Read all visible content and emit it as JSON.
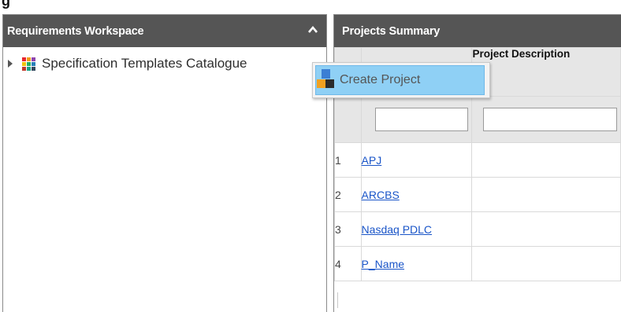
{
  "left_panel": {
    "title": "Requirements Workspace",
    "tree": [
      {
        "label": "Specification Templates Catalogue"
      }
    ]
  },
  "right_panel": {
    "title": "Projects Summary",
    "columns": [
      "",
      "",
      "Project Description"
    ],
    "rows": [
      {
        "index": "1",
        "name": "APJ"
      },
      {
        "index": "2",
        "name": "ARCBS"
      },
      {
        "index": "3",
        "name": "Nasdaq PDLC"
      },
      {
        "index": "4",
        "name": "P_Name"
      }
    ]
  },
  "context_menu": {
    "items": [
      {
        "label": "Create Project",
        "icon": "create-project-icon"
      }
    ]
  },
  "colors": {
    "header_bg": "#555555",
    "menu_highlight": "#8fd0f5",
    "link": "#1a55c8"
  }
}
